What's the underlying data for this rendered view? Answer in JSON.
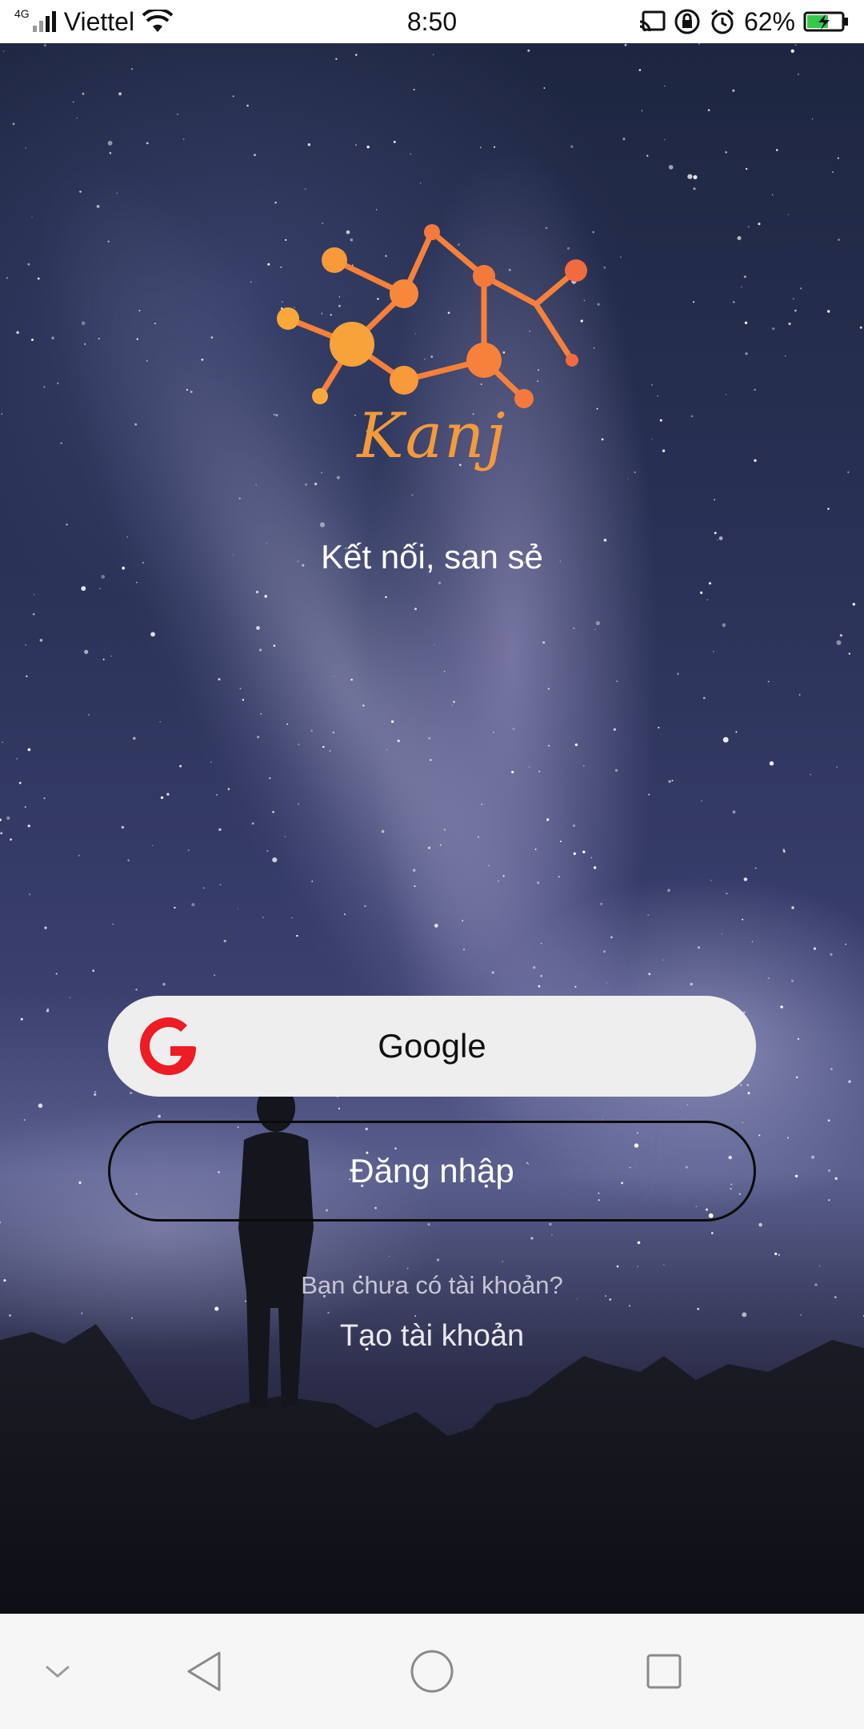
{
  "status_bar": {
    "network_type": "4G",
    "carrier": "Viettel",
    "time": "8:50",
    "battery_percent": "62%",
    "battery_level": 0.62,
    "icons": [
      "signal-icon",
      "wifi-icon",
      "cast-icon",
      "rotation-lock-icon",
      "alarm-icon",
      "battery-charging-icon"
    ]
  },
  "app": {
    "logo_text": "Kanj",
    "tagline": "Kết nối, san sẻ",
    "accent_color": "#f39a3b"
  },
  "actions": {
    "google_label": "Google",
    "login_label": "Đăng nhập",
    "no_account_text": "Bạn chưa có tài khoản?",
    "create_account_label": "Tạo tài khoản"
  },
  "nav_bar": {
    "buttons": [
      "hide-nav-icon",
      "back-icon",
      "home-icon",
      "recents-icon"
    ]
  }
}
